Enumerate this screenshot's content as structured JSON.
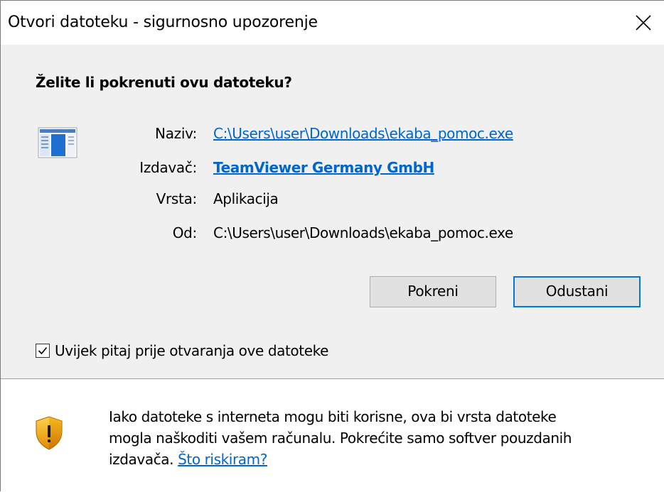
{
  "window": {
    "title": "Otvori datoteku - sigurnosno upozorenje"
  },
  "question": "Želite li pokrenuti ovu datoteku?",
  "fields": {
    "name": {
      "label": "Naziv:",
      "value": "C:\\Users\\user\\Downloads\\ekaba_pomoc.exe"
    },
    "publisher": {
      "label": "Izdavač:",
      "value": "TeamViewer Germany GmbH"
    },
    "type": {
      "label": "Vrsta:",
      "value": "Aplikacija"
    },
    "from": {
      "label": "Od:",
      "value": "C:\\Users\\user\\Downloads\\ekaba_pomoc.exe"
    }
  },
  "buttons": {
    "run": "Pokreni",
    "cancel": "Odustani"
  },
  "checkbox": {
    "label": "Uvijek pitaj prije otvaranja ove datoteke",
    "checked": true
  },
  "warning": {
    "line1": "Iako datoteke s interneta mogu biti korisne, ova bi vrsta datoteke",
    "line2": "mogla naškoditi vašem računalu. Pokrećite samo softver pouzdanih",
    "line3_prefix": "izdavača.",
    "link": "Što riskiram?"
  },
  "icons": {
    "app": "application-icon",
    "shield": "warning-shield-icon",
    "close": "close-icon",
    "check": "check-icon"
  },
  "colors": {
    "link": "#0066cc",
    "default_button_border": "#0078d7",
    "dialog_bg": "#f0f0f0"
  }
}
